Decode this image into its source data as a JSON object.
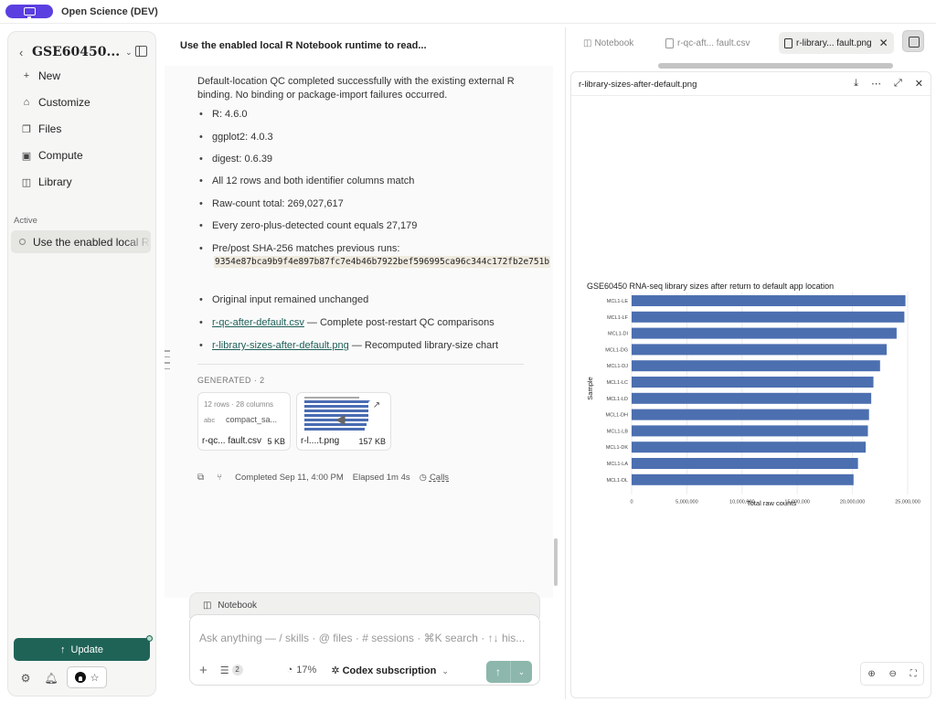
{
  "app": {
    "title": "Open Science (DEV)"
  },
  "sidebar": {
    "title": "GSE60450...",
    "items": [
      {
        "icon": "plus-icon",
        "label": "New"
      },
      {
        "icon": "customize-icon",
        "label": "Customize"
      },
      {
        "icon": "files-icon",
        "label": "Files"
      },
      {
        "icon": "compute-icon",
        "label": "Compute"
      },
      {
        "icon": "library-icon",
        "label": "Library"
      }
    ],
    "section_label": "Active",
    "active_session": "Use the enabled local R Notebook runtime to read...",
    "update_label": "Update"
  },
  "conversation": {
    "title": "Use the enabled local R Notebook runtime to read...",
    "message": "Default-location QC completed successfully with the existing external R binding. No binding or package-import failures occurred.",
    "bullets": [
      "R: 4.6.0",
      "ggplot2: 4.0.3",
      "digest: 0.6.39",
      "All 12 rows and both identifier columns match",
      "Raw-count total: 269,027,617",
      "Every zero-plus-detected count equals 27,179",
      "Pre/post SHA-256 matches previous runs:",
      "Original input remained unchanged"
    ],
    "hash": "9354e87bca9b9f4e897b87fc7e4b46b7922bef596995ca96c344c172fb2e751b",
    "links": [
      {
        "name": "r-qc-after-default.csv",
        "desc": " — Complete post-restart QC comparisons"
      },
      {
        "name": "r-library-sizes-after-default.png",
        "desc": " — Recomputed library-size chart"
      }
    ],
    "generated_label": "GENERATED · 2",
    "files": [
      {
        "meta": "12 rows · 28 columns",
        "type": "abc",
        "column": "compact_sa...",
        "name": "r-qc... fault.csv",
        "size": "5 KB"
      },
      {
        "name": "r-l....t.png",
        "size": "157 KB"
      }
    ],
    "status": {
      "completed": "Completed Sep 11, 4:00 PM",
      "elapsed": "Elapsed 1m 4s",
      "calls": "Calls"
    }
  },
  "composer": {
    "tab_label": "Notebook",
    "placeholder": "Ask anything — / skills · @ files · # sessions · ⌘K search · ↑↓ his...",
    "tools_count": "2",
    "context_usage": "17%",
    "model": "Codex subscription"
  },
  "viewer": {
    "tabs": [
      {
        "label": "Notebook",
        "active": false
      },
      {
        "label": "r-qc-aft... fault.csv",
        "active": false
      },
      {
        "label": "r-library... fault.png",
        "active": true
      }
    ],
    "file_title": "r-library-sizes-after-default.png"
  },
  "chart_data": {
    "type": "bar",
    "orientation": "horizontal",
    "title": "GSE60450 RNA-seq library sizes after return to default app location",
    "xlabel": "Total raw counts",
    "ylabel": "Sample",
    "xlim": [
      0,
      25000000
    ],
    "xticks": [
      0,
      5000000,
      10000000,
      15000000,
      20000000,
      25000000
    ],
    "xtick_labels": [
      "0",
      "5,000,000",
      "10,000,000",
      "15,000,000",
      "20,000,000",
      "25,000,000"
    ],
    "categories": [
      "MCL1-LE",
      "MCL1-LF",
      "MCL1-DI",
      "MCL1-DG",
      "MCL1-DJ",
      "MCL1-LC",
      "MCL1-LD",
      "MCL1-DH",
      "MCL1-LB",
      "MCL1-DK",
      "MCL1-LA",
      "MCL1-DL"
    ],
    "values": [
      24800000,
      24700000,
      24000000,
      23100000,
      22500000,
      21900000,
      21700000,
      21500000,
      21400000,
      21200000,
      20500000,
      20100000
    ],
    "bar_color": "#4c6fb0",
    "grid": true
  }
}
